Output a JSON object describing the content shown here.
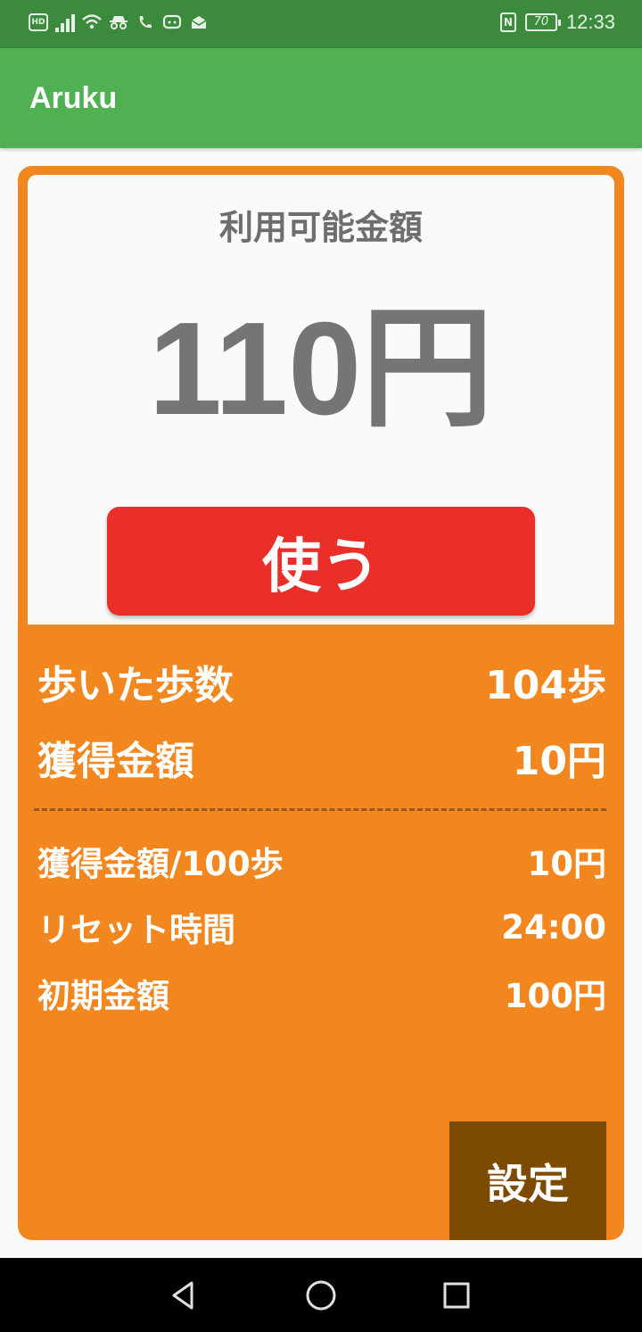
{
  "status_bar": {
    "hd_badge": "HD",
    "battery_level": "70",
    "time": "12:33",
    "nfc_badge": "N",
    "icons": [
      "hd-icon",
      "signal-icon",
      "wifi-icon",
      "incognito-icon",
      "call-icon",
      "chat-icon",
      "mail-icon",
      "nfc-icon",
      "battery-icon"
    ]
  },
  "app_bar": {
    "title": "Aruku"
  },
  "balance": {
    "label": "利用可能金額",
    "amount": "110円",
    "use_button": "使う"
  },
  "stats": {
    "steps_label": "歩いた歩数",
    "steps_value": "104歩",
    "earned_label": "獲得金額",
    "earned_value": "10円"
  },
  "settings_info": {
    "rate_label": "獲得金額/100歩",
    "rate_value": "10円",
    "reset_label": "リセット時間",
    "reset_value": "24:00",
    "initial_label": "初期金額",
    "initial_value": "100円"
  },
  "settings_button": "設定",
  "colors": {
    "status_bar": "#3b8a3e",
    "app_bar": "#4fb152",
    "card_orange": "#f2861f",
    "use_button_red": "#ea2f2b",
    "settings_button_brown": "#7c4a00"
  },
  "nav_bar": {
    "icons": [
      "back-icon",
      "home-icon",
      "recents-icon"
    ]
  }
}
